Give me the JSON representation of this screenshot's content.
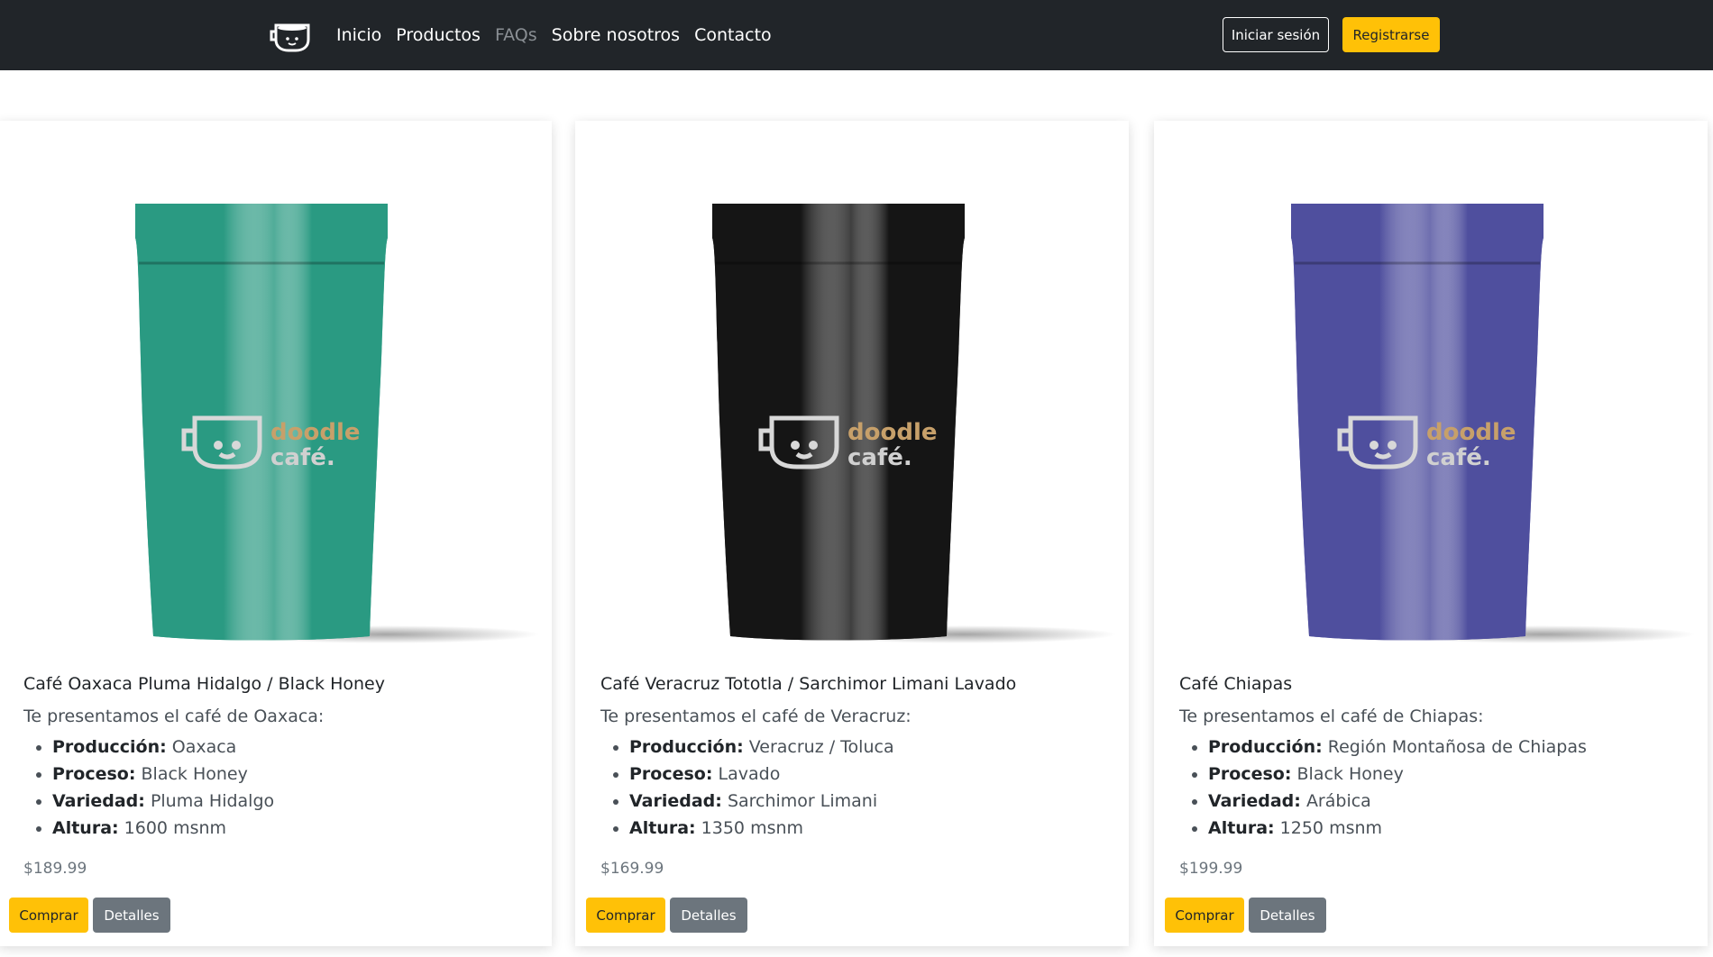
{
  "nav": {
    "logo_icon": "cup-icon",
    "links": [
      "Inicio",
      "Productos",
      "FAQs",
      "Sobre nosotros",
      "Contacto"
    ],
    "login_label": "Iniciar sesión",
    "register_label": "Registrarse"
  },
  "colors": {
    "navbar": "#212529",
    "accent": "#ffc107",
    "secondary": "#6c757d"
  },
  "products": [
    {
      "title": "Café Oaxaca Pluma Hidalgo / Black Honey",
      "intro": "Te presentamos el café de Oaxaca:",
      "specs": [
        {
          "label": "Producción:",
          "value": "Oaxaca"
        },
        {
          "label": "Proceso:",
          "value": "Black Honey"
        },
        {
          "label": "Variedad:",
          "value": "Pluma Hidalgo"
        },
        {
          "label": "Altura:",
          "value": "1600 msnm"
        }
      ],
      "price": "$189.99",
      "buy_label": "Comprar",
      "details_label": "Detalles",
      "bag_brand_line1": "doodle",
      "bag_brand_line2": "café.",
      "bag_color": "#2a9a82"
    },
    {
      "title": "Café Veracruz Tototla / Sarchimor Limani Lavado",
      "intro": "Te presentamos el café de Veracruz:",
      "specs": [
        {
          "label": "Producción:",
          "value": "Veracruz / Toluca"
        },
        {
          "label": "Proceso:",
          "value": "Lavado"
        },
        {
          "label": "Variedad:",
          "value": "Sarchimor Limani"
        },
        {
          "label": "Altura:",
          "value": "1350 msnm"
        }
      ],
      "price": "$169.99",
      "buy_label": "Comprar",
      "details_label": "Detalles",
      "bag_brand_line1": "doodle",
      "bag_brand_line2": "café.",
      "bag_color": "#151515"
    },
    {
      "title": "Café Chiapas",
      "intro": "Te presentamos el café de Chiapas:",
      "specs": [
        {
          "label": "Producción:",
          "value": "Región Montañosa de Chiapas"
        },
        {
          "label": "Proceso:",
          "value": "Black Honey"
        },
        {
          "label": "Variedad:",
          "value": "Arábica"
        },
        {
          "label": "Altura:",
          "value": "1250 msnm"
        }
      ],
      "price": "$199.99",
      "buy_label": "Comprar",
      "details_label": "Detalles",
      "bag_brand_line1": "doodle",
      "bag_brand_line2": "café.",
      "bag_color": "#4f4f9e"
    }
  ]
}
